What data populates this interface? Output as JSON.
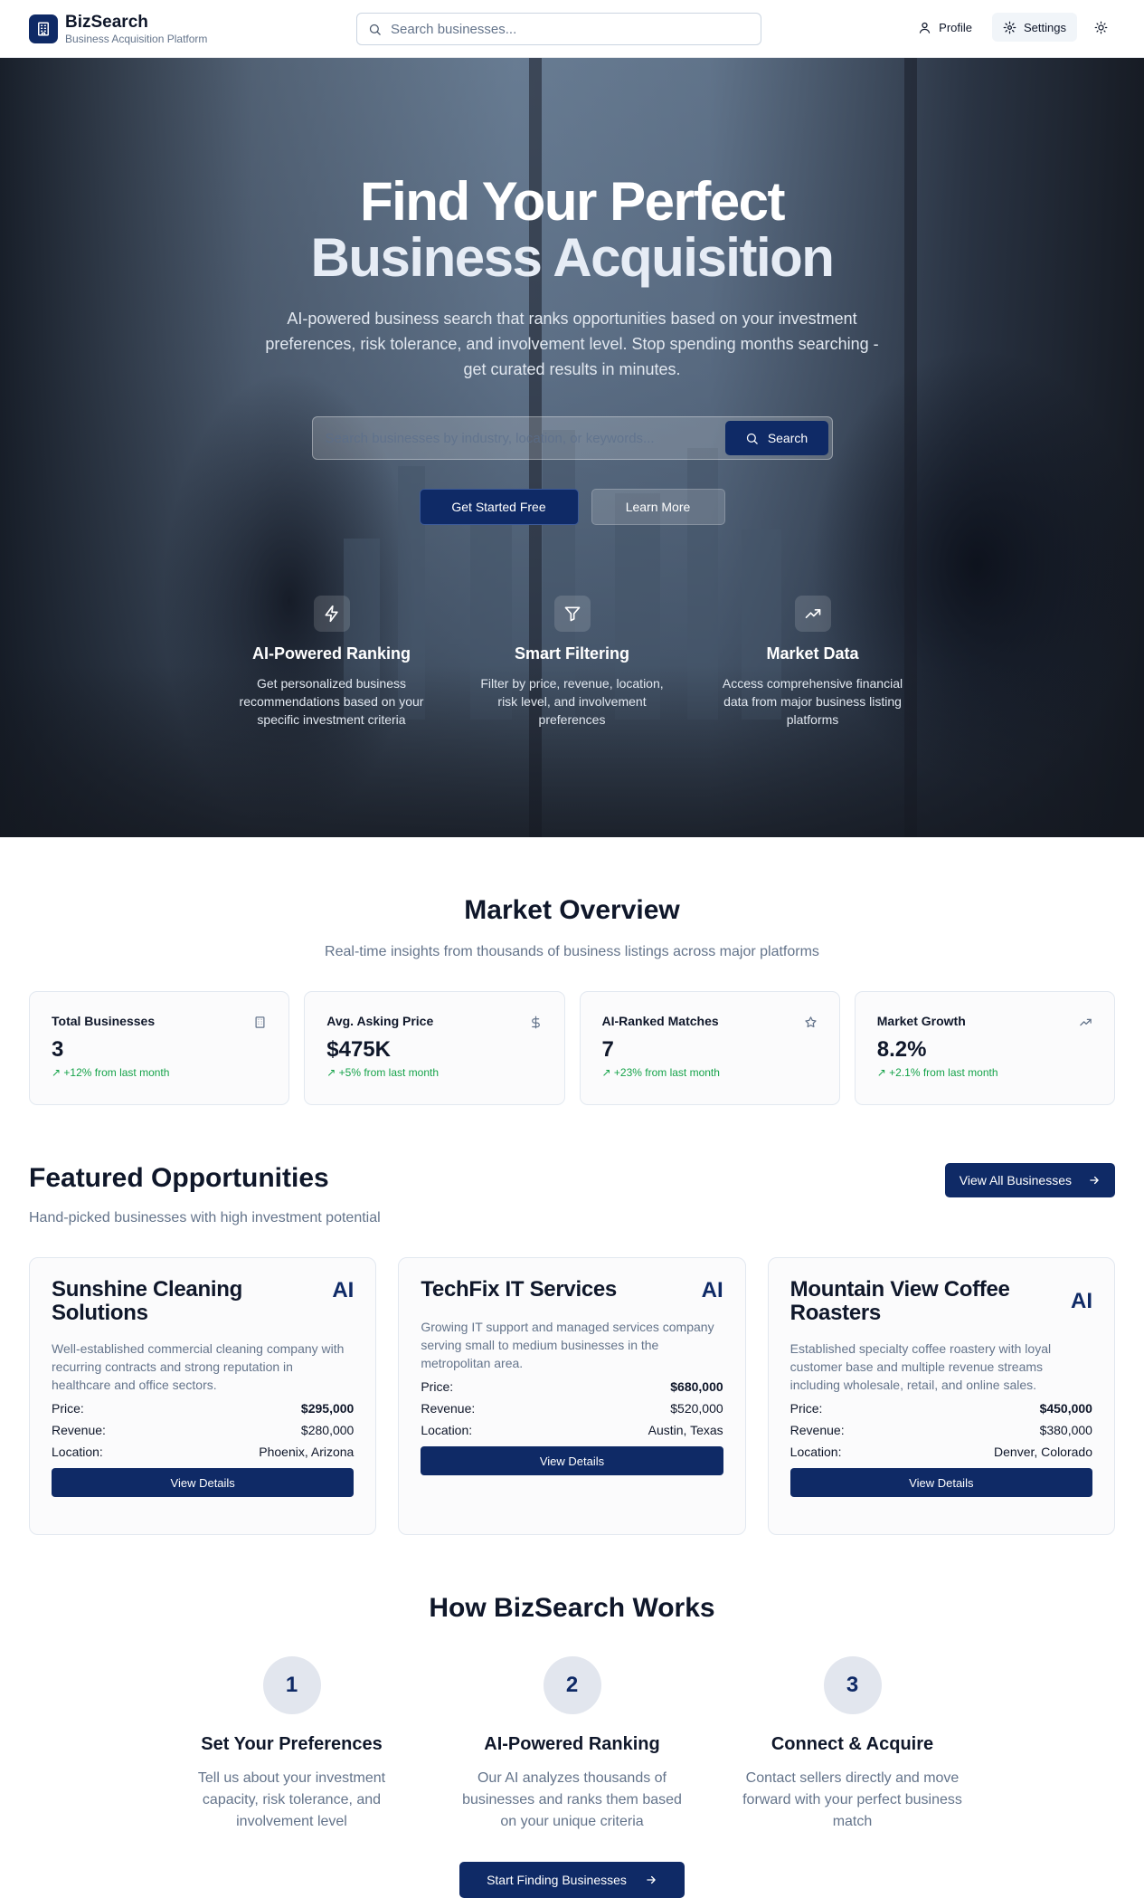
{
  "header": {
    "brand_name": "BizSearch",
    "brand_tagline": "Business Acquisition Platform",
    "search_placeholder": "Search businesses...",
    "profile_label": "Profile",
    "settings_label": "Settings"
  },
  "hero": {
    "title_line1": "Find Your Perfect",
    "title_line2": "Business Acquisition",
    "description": "AI-powered business search that ranks opportunities based on your investment preferences, risk tolerance, and involvement level. Stop spending months searching - get curated results in minutes.",
    "search_placeholder": "Search businesses by industry, location, or keywords...",
    "search_button": "Search",
    "cta_primary": "Get Started Free",
    "cta_secondary": "Learn More",
    "features": [
      {
        "icon": "zap-icon",
        "title": "AI-Powered Ranking",
        "desc": "Get personalized business recommendations based on your specific investment criteria"
      },
      {
        "icon": "filter-icon",
        "title": "Smart Filtering",
        "desc": "Filter by price, revenue, location, risk level, and involvement preferences"
      },
      {
        "icon": "trending-up-icon",
        "title": "Market Data",
        "desc": "Access comprehensive financial data from major business listing platforms"
      }
    ]
  },
  "market": {
    "title": "Market Overview",
    "subtitle": "Real-time insights from thousands of business listings across major platforms",
    "stats": [
      {
        "label": "Total Businesses",
        "value": "3",
        "change": "↗ +12% from last month",
        "icon": "building-icon"
      },
      {
        "label": "Avg. Asking Price",
        "value": "$475K",
        "change": "↗ +5% from last month",
        "icon": "dollar-icon"
      },
      {
        "label": "AI-Ranked Matches",
        "value": "7",
        "change": "↗ +23% from last month",
        "icon": "star-icon"
      },
      {
        "label": "Market Growth",
        "value": "8.2%",
        "change": "↗ +2.1% from last month",
        "icon": "trending-up-icon"
      }
    ]
  },
  "featured": {
    "title": "Featured Opportunities",
    "subtitle": "Hand-picked businesses with high investment potential",
    "view_all": "View All Businesses",
    "labels": {
      "price": "Price:",
      "revenue": "Revenue:",
      "location": "Location:",
      "badge": "AI",
      "details": "View Details"
    },
    "cards": [
      {
        "name": "Sunshine Cleaning Solutions",
        "desc": "Well-established commercial cleaning company with recurring contracts and strong reputation in healthcare and office sectors.",
        "price": "$295,000",
        "revenue": "$280,000",
        "location": "Phoenix, Arizona"
      },
      {
        "name": "TechFix IT Services",
        "desc": "Growing IT support and managed services company serving small to medium businesses in the metropolitan area.",
        "price": "$680,000",
        "revenue": "$520,000",
        "location": "Austin, Texas"
      },
      {
        "name": "Mountain View Coffee Roasters",
        "desc": "Established specialty coffee roastery with loyal customer base and multiple revenue streams including wholesale, retail, and online sales.",
        "price": "$450,000",
        "revenue": "$380,000",
        "location": "Denver, Colorado"
      }
    ]
  },
  "how": {
    "title": "How BizSearch Works",
    "steps": [
      {
        "num": "1",
        "title": "Set Your Preferences",
        "desc": "Tell us about your investment capacity, risk tolerance, and involvement level"
      },
      {
        "num": "2",
        "title": "AI-Powered Ranking",
        "desc": "Our AI analyzes thousands of businesses and ranks them based on your unique criteria"
      },
      {
        "num": "3",
        "title": "Connect & Acquire",
        "desc": "Contact sellers directly and move forward with your perfect business match"
      }
    ],
    "cta": "Start Finding Businesses"
  },
  "colors": {
    "primary": "#0f2a66",
    "positive": "#16a34a",
    "muted": "#64748b"
  }
}
